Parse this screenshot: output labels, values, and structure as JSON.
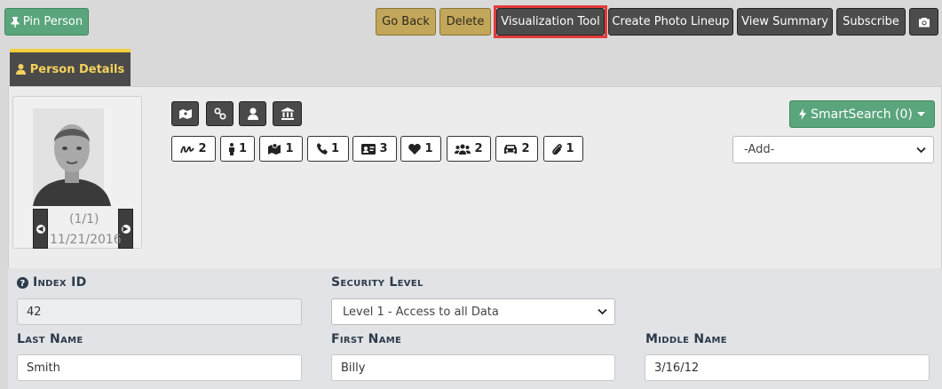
{
  "toolbar": {
    "pin_person": "Pin Person",
    "go_back": "Go Back",
    "delete": "Delete",
    "visualization_tool": "Visualization Tool",
    "create_photo_lineup": "Create Photo Lineup",
    "view_summary": "View Summary",
    "subscribe": "Subscribe"
  },
  "tabs": {
    "person_details": "Person Details"
  },
  "photo": {
    "count": "(1/1)",
    "date": "11/21/2016"
  },
  "counts": {
    "signature": "2",
    "person": "1",
    "map": "1",
    "phone": "1",
    "id_card": "3",
    "heart": "1",
    "users": "2",
    "car": "2",
    "attachment": "1"
  },
  "smartsearch": {
    "label": "SmartSearch (0)"
  },
  "add_select": {
    "value": "-Add-"
  },
  "form": {
    "index_id": {
      "label": "Index ID",
      "value": "42"
    },
    "security_level": {
      "label": "Security Level",
      "value": "Level 1 - Access to all Data"
    },
    "last_name": {
      "label": "Last Name",
      "value": "Smith"
    },
    "first_name": {
      "label": "First Name",
      "value": "Billy"
    },
    "middle_name": {
      "label": "Middle Name",
      "value": "3/16/12"
    }
  },
  "colors": {
    "accent_green": "#5aa57c",
    "gold": "#c2a65a",
    "dark": "#4c4c4c",
    "highlight": "#e23b3b",
    "tab_accent": "#f2cf3b"
  }
}
